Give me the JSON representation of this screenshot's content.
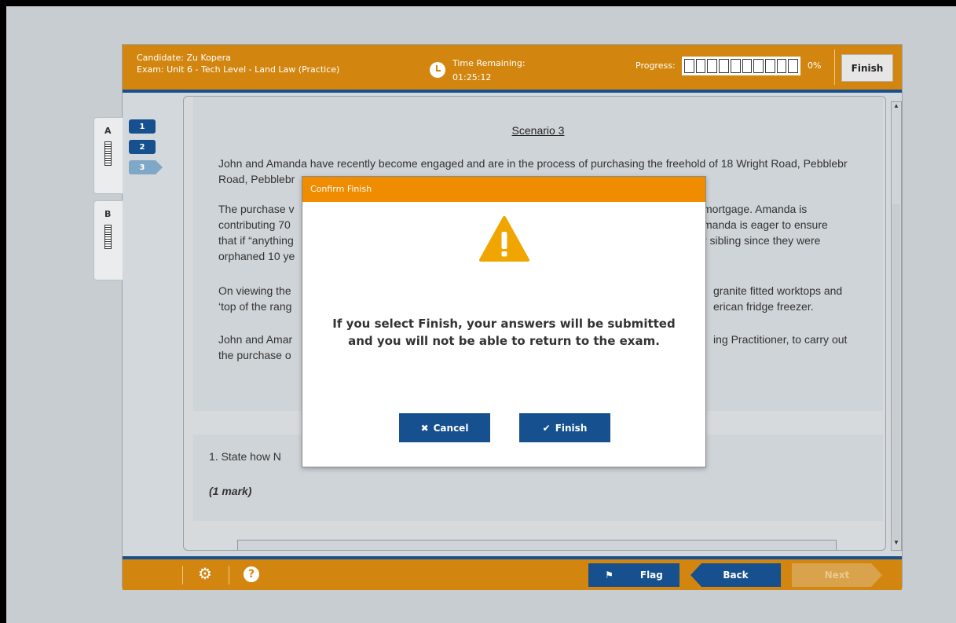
{
  "header": {
    "candidate": "Candidate: Zu Kopera",
    "exam": "Exam: Unit 6 - Tech Level - Land Law (Practice)",
    "time_label": "Time Remaining:",
    "time_value": "01:25:12",
    "progress_label": "Progress:",
    "progress_percent": "0%",
    "progress_value": 0,
    "finish_label": "Finish"
  },
  "sections": [
    {
      "label": "A"
    },
    {
      "label": "B"
    }
  ],
  "questions_nav": [
    "1",
    "2",
    "3"
  ],
  "content": {
    "title": "Scenario 3",
    "p1": "John and Amanda have recently become engaged and are in the process of purchasing the freehold of 18 Wright Road, Pebblebr",
    "p2a": "The purchase v",
    "p2a_right": "mortgage. Amanda is",
    "p2b": "contributing 70",
    "p2b_right": "manda is eager to ensure",
    "p2c": "that if “anything",
    "p2c_right": "r sibling since they were",
    "p2d": "orphaned 10 ye",
    "p3a": "On viewing the",
    "p3a_right": "granite fitted worktops and",
    "p3b": "‘top of the rang",
    "p3b_right": "erican fridge freezer.",
    "p4a": "John and Amar",
    "p4a_right": "ing Practitioner, to carry out",
    "p4b": "the purchase o",
    "question": "1.  State how N",
    "mark": "(1 mark)"
  },
  "footer": {
    "flag_label": "Flag",
    "back_label": "Back",
    "next_label": "Next"
  },
  "modal": {
    "title": "Confirm Finish",
    "message_line1": "If you select Finish, your answers will be submitted",
    "message_line2": "and you will not be able to return to the exam.",
    "cancel_label": "Cancel",
    "finish_label": "Finish"
  },
  "colors": {
    "accent": "#d3860f",
    "brand_blue": "#16508f",
    "modal_header": "#ef8c00",
    "warning": "#f0a500"
  },
  "icons": [
    "clock-icon",
    "gear-icon",
    "help-icon",
    "flag-icon",
    "warning-icon",
    "close-icon",
    "checkmark-icon"
  ]
}
